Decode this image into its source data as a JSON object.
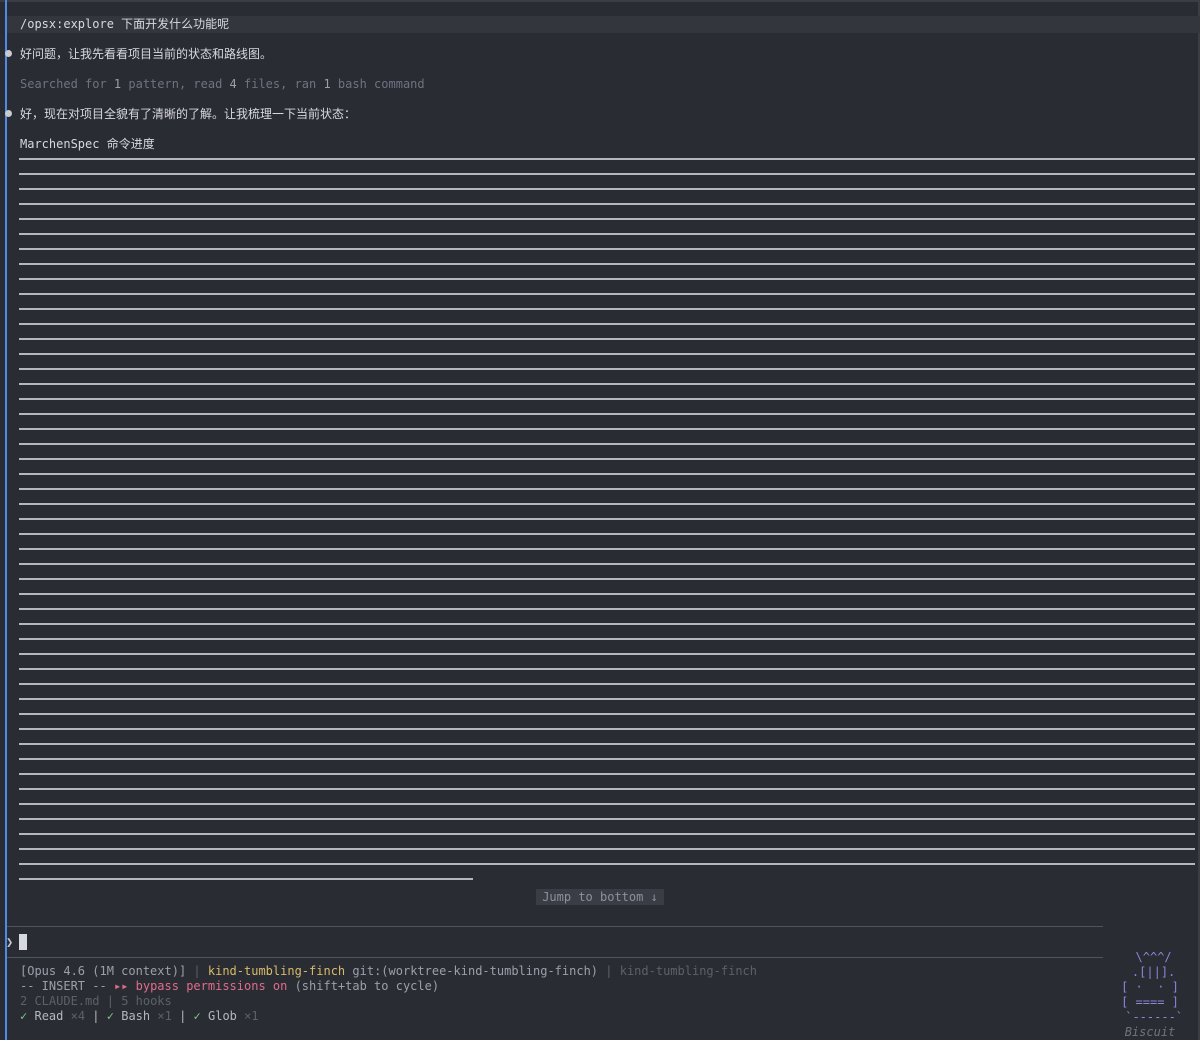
{
  "conversation": {
    "prompt": "/opsx:explore 下面开发什么功能呢",
    "reply1": "好问题，让我先看看项目当前的状态和路线图。",
    "tool_summary": {
      "prefix": "Searched for ",
      "n1": "1",
      "mid1": " pattern, read ",
      "n2": "4",
      "mid2": " files, ran ",
      "n3": "1",
      "suffix": " bash command"
    },
    "reply2": "好，现在对项目全貌有了清晰的了解。让我梳理一下当前状态：",
    "section_title": "MarchenSpec 命令进度"
  },
  "jump_button": "Jump to bottom ↓",
  "input": {
    "caret": "❯"
  },
  "status": {
    "model": "[Opus 4.6 (1M context)]",
    "sep": "|",
    "worktree": "kind-tumbling-finch",
    "git": "git:(worktree-kind-tumbling-finch)",
    "session": "kind-tumbling-finch",
    "mode": "-- INSERT --",
    "bypass_icon": "▸▸",
    "bypass": "bypass permissions on",
    "bypass_hint": "(shift+tab to cycle)",
    "claude_md": "2 CLAUDE.md",
    "hooks": "5 hooks",
    "tools": [
      {
        "check": "✓",
        "name": "Read",
        "count": "×4"
      },
      {
        "check": "✓",
        "name": "Bash",
        "count": "×1"
      },
      {
        "check": "✓",
        "name": "Glob",
        "count": "×1"
      }
    ]
  },
  "buddy": {
    "art": " \\^^^/\n .[||].\n[ ·  · ]\n[ ==== ]\n `------`",
    "name": "Biscuit"
  },
  "colors": {
    "background": "#2a2c33",
    "accent_bar": "#4d8be6",
    "worktree": "#d7ba6a",
    "bypass": "#e06c8a",
    "check": "#7fc78a",
    "buddy": "#8a86d9"
  }
}
